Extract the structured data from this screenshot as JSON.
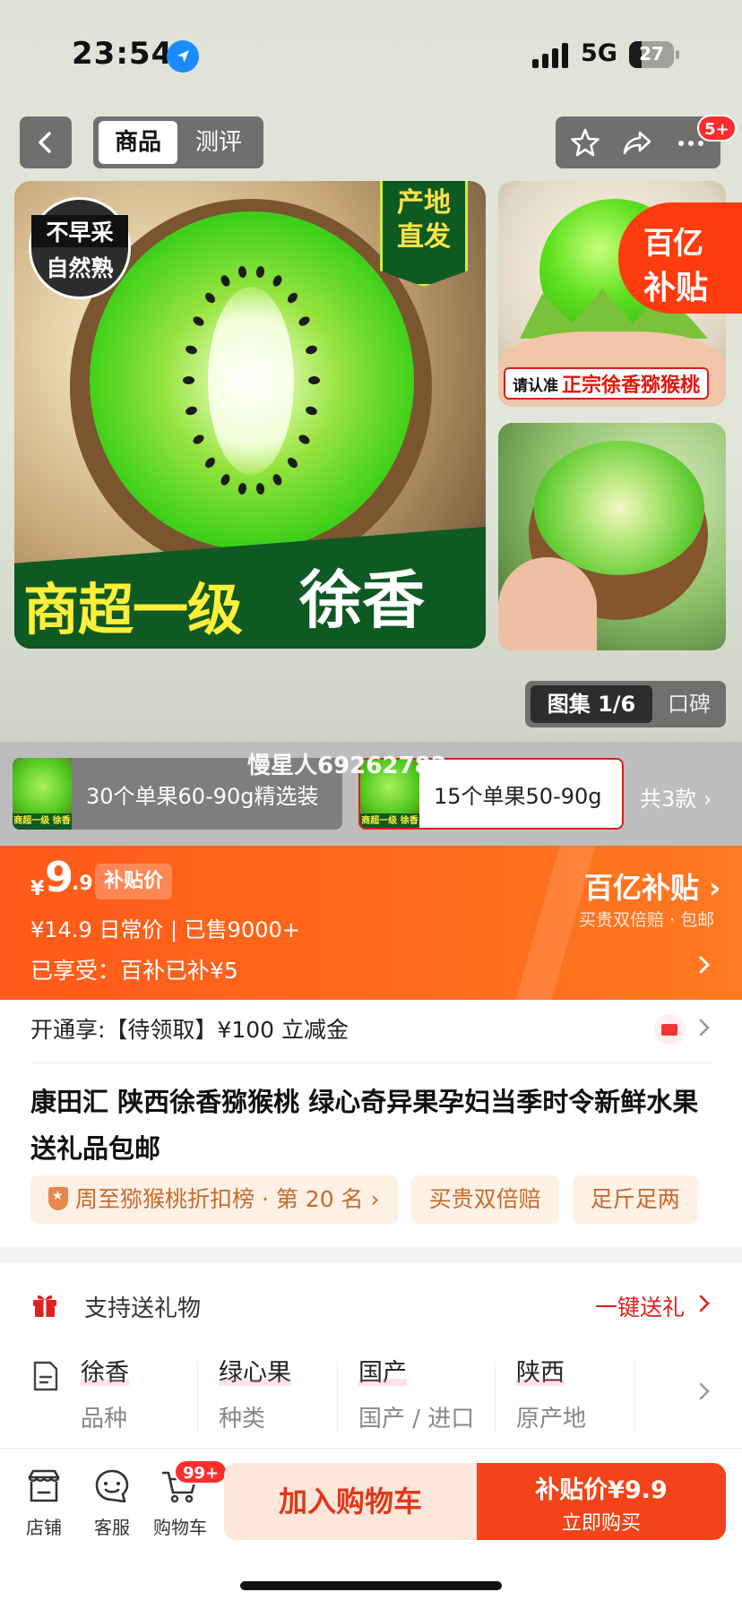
{
  "status_bar": {
    "time": "23:54",
    "network": "5G",
    "battery": "27",
    "battery_level": 0.27
  },
  "nav": {
    "tabs": [
      "商品",
      "测评"
    ],
    "active_tab": "商品",
    "more_badge": "5+"
  },
  "gallery": {
    "main_badge_top": "不早采",
    "main_badge_bottom": "自然熟",
    "origin_tag_1": "产地",
    "origin_tag_2": "直发",
    "banner_left": "商超一级",
    "banner_right": "徐香",
    "side_label_prefix": "请认准",
    "side_label_main": "正宗徐香猕猴桃",
    "subsidy_corner_1": "百亿",
    "subsidy_corner_2": "补贴",
    "album_label": "图集 1/6",
    "review_label": "口碑"
  },
  "sku": {
    "items": [
      {
        "label": "30个单果60-90g精选装",
        "selected": false
      },
      {
        "label": "15个单果50-90g",
        "selected": true
      }
    ],
    "thumb_text": "商超一级 徐香",
    "watermark": "慢星人69262782",
    "total": "共3款 ›"
  },
  "price": {
    "yen": "¥",
    "integer": "9",
    "decimal": ".9",
    "tag": "补贴价",
    "row2": "¥14.9  日常价 | 已售9000+",
    "row3": "已享受：百补已补¥5",
    "brand": "百亿补贴 ›",
    "brand_sub": "买贵双倍赔 · 包邮"
  },
  "info": {
    "open_row": "开通享:【待领取】¥100 立减金",
    "title": "康田汇 陕西徐香猕猴桃 绿心奇异果孕妇当季时令新鲜水果送礼品包邮",
    "tags": [
      "周至猕猴桃折扣榜 · 第 20 名 ›",
      "买贵双倍赔",
      "足斤足两"
    ]
  },
  "attributes": {
    "gift_label": "支持送礼物",
    "gift_link": "一键送礼",
    "items": [
      {
        "value": "徐香",
        "key": "品种"
      },
      {
        "value": "绿心果",
        "key": "种类"
      },
      {
        "value": "国产",
        "key": "国产 / 进口"
      },
      {
        "value": "陕西",
        "key": "原产地"
      }
    ]
  },
  "bottom": {
    "store": "店铺",
    "service": "客服",
    "cart": "购物车",
    "cart_badge": "99+",
    "add_to_cart": "加入购物车",
    "buy_price": "补贴价¥9.9",
    "buy_label": "立即购买"
  },
  "colors": {
    "accent": "#ff5a1a",
    "buy": "#f24418",
    "cart_bg": "#fde6da",
    "red": "#e02020"
  }
}
